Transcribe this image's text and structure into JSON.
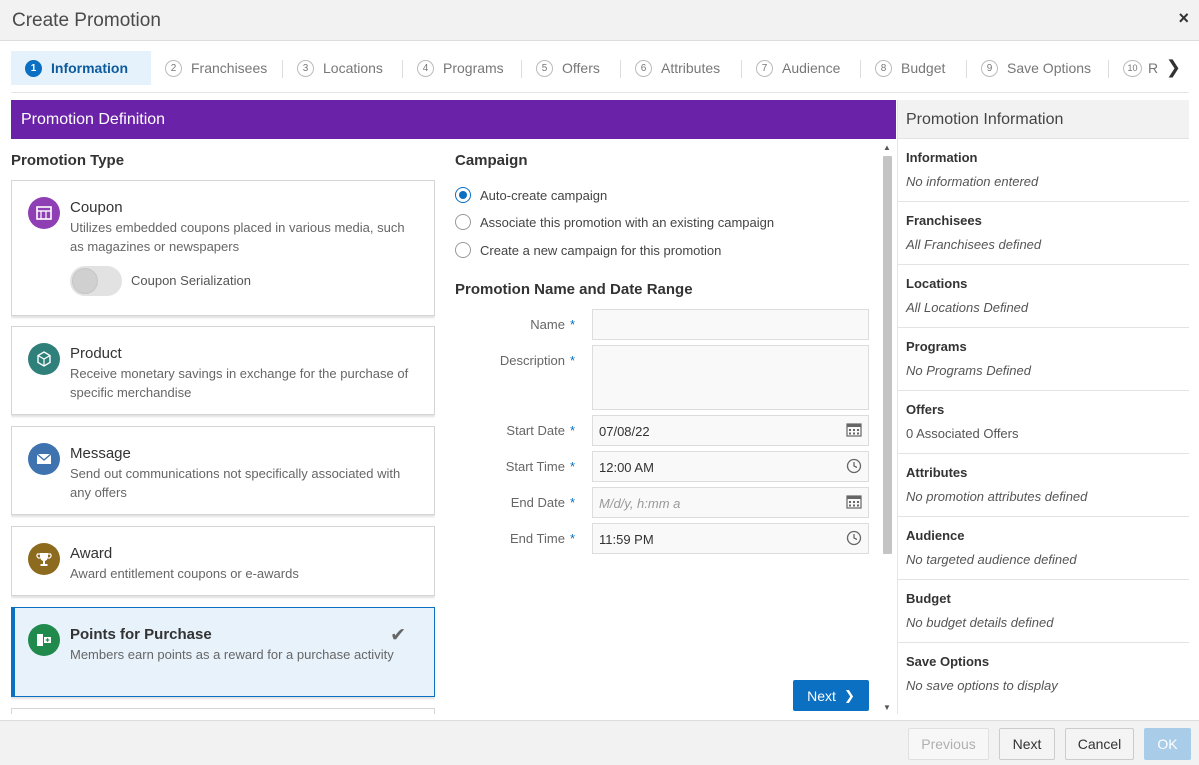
{
  "window": {
    "title": "Create Promotion",
    "close": "×"
  },
  "steps": [
    {
      "num": "1",
      "label": "Information"
    },
    {
      "num": "2",
      "label": "Franchisees"
    },
    {
      "num": "3",
      "label": "Locations"
    },
    {
      "num": "4",
      "label": "Programs"
    },
    {
      "num": "5",
      "label": "Offers"
    },
    {
      "num": "6",
      "label": "Attributes"
    },
    {
      "num": "7",
      "label": "Audience"
    },
    {
      "num": "8",
      "label": "Budget"
    },
    {
      "num": "9",
      "label": "Save Options"
    },
    {
      "num": "10",
      "label": "R"
    }
  ],
  "section_header": "Promotion Definition",
  "promotion_type": {
    "heading": "Promotion Type",
    "cards": [
      {
        "title": "Coupon",
        "desc": "Utilizes embedded coupons placed in various media, such as magazines or newspapers",
        "toggle_label": "Coupon Serialization"
      },
      {
        "title": "Product",
        "desc": "Receive monetary savings in exchange for the purchase of specific merchandise"
      },
      {
        "title": "Message",
        "desc": "Send out communications not specifically associated with any offers"
      },
      {
        "title": "Award",
        "desc": "Award entitlement coupons or e-awards"
      },
      {
        "title": "Points for Purchase",
        "desc": "Members earn points as a reward for a purchase activity"
      }
    ]
  },
  "campaign": {
    "heading": "Campaign",
    "options": [
      "Auto-create campaign",
      "Associate this promotion with an existing campaign",
      "Create a new campaign for this promotion"
    ]
  },
  "name_date": {
    "heading": "Promotion Name and Date Range",
    "name_label": "Name",
    "description_label": "Description",
    "start_date_label": "Start Date",
    "start_date_value": "07/08/22",
    "start_time_label": "Start Time",
    "start_time_value": "12:00 AM",
    "end_date_label": "End Date",
    "end_date_placeholder": "M/d/y, h:mm a",
    "end_time_label": "End Time",
    "end_time_value": "11:59 PM",
    "required": "*",
    "next_label": "Next"
  },
  "info_panel": {
    "title": "Promotion Information",
    "sections": [
      {
        "title": "Information",
        "value": "No information entered"
      },
      {
        "title": "Franchisees",
        "value": "All Franchisees defined"
      },
      {
        "title": "Locations",
        "value": "All Locations Defined"
      },
      {
        "title": "Programs",
        "value": "No Programs Defined"
      },
      {
        "title": "Offers",
        "value": "0 Associated Offers"
      },
      {
        "title": "Attributes",
        "value": "No promotion attributes defined"
      },
      {
        "title": "Audience",
        "value": "No targeted audience defined"
      },
      {
        "title": "Budget",
        "value": "No budget details defined"
      },
      {
        "title": "Save Options",
        "value": "No save options to display"
      }
    ]
  },
  "footer": {
    "previous": "Previous",
    "next": "Next",
    "cancel": "Cancel",
    "ok": "OK"
  },
  "colors": {
    "accent": "#0b6fc2",
    "header_purple": "#6a22a8",
    "coupon": "#8e3fb4",
    "product": "#2f7f7a",
    "message": "#3e73b0",
    "award": "#8c6a1e",
    "points": "#1f8a4c"
  }
}
